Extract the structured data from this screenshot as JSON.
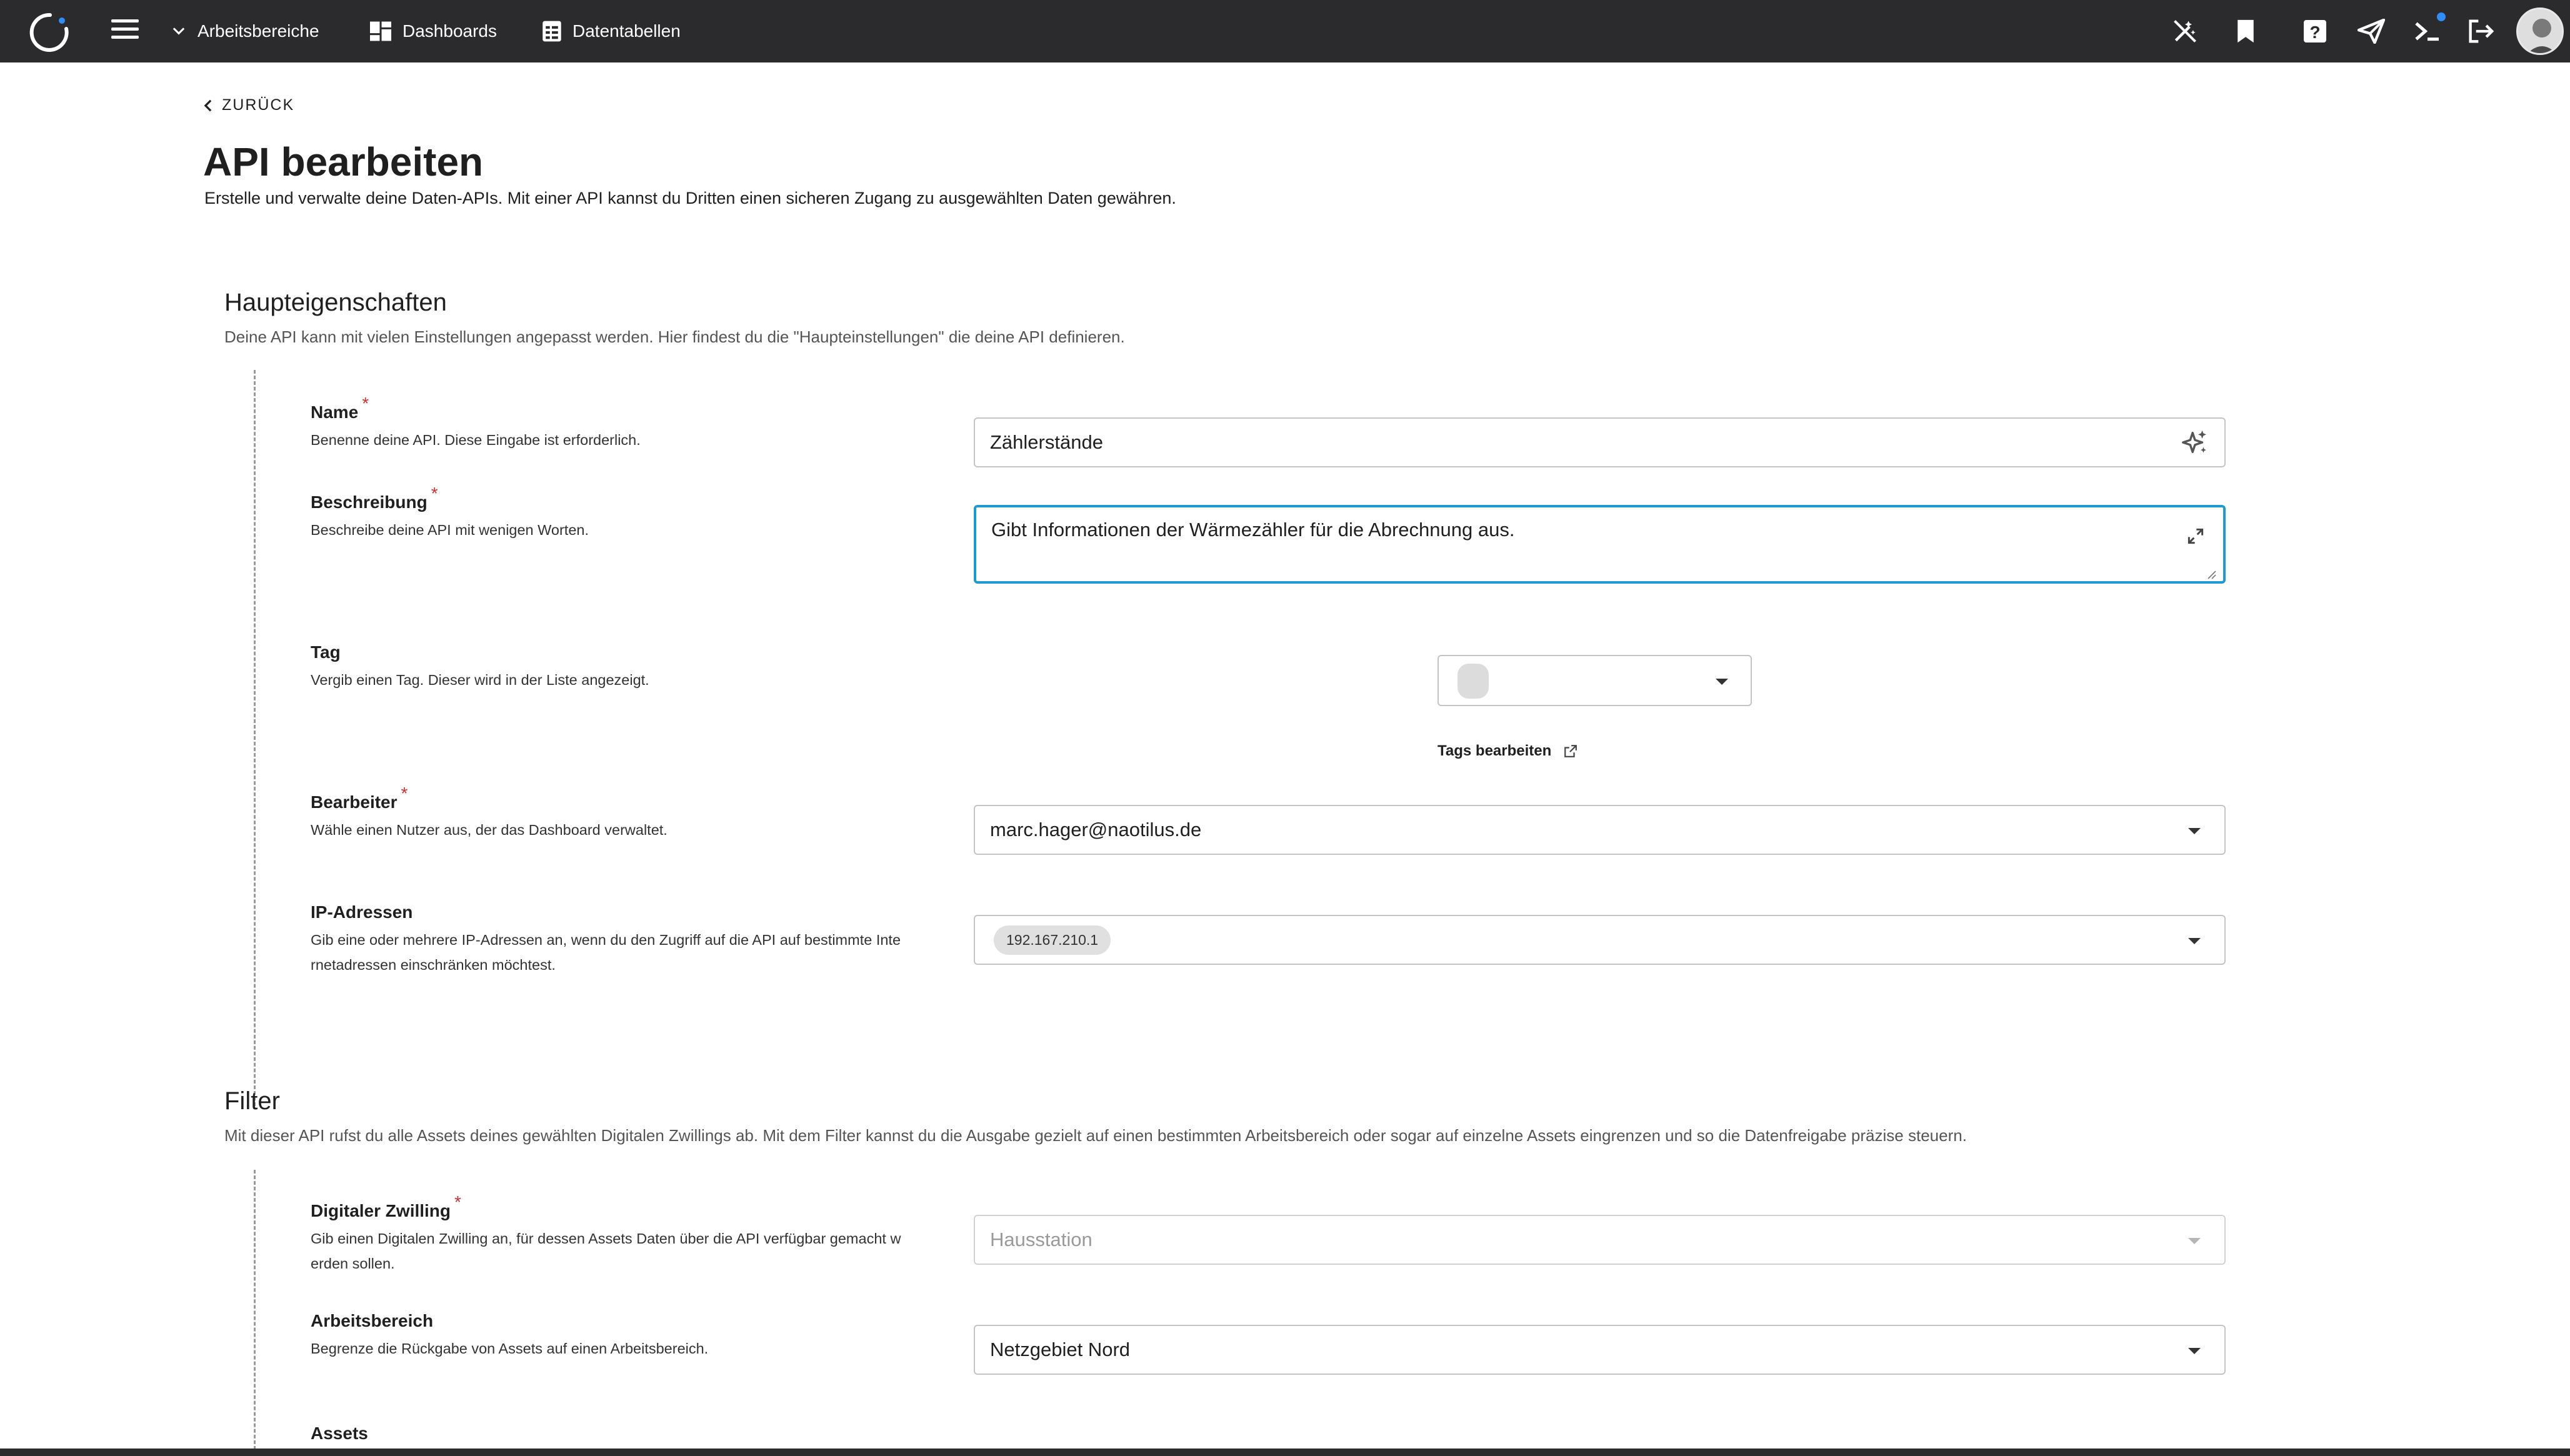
{
  "topbar": {
    "nav": [
      {
        "label": "Arbeitsbereiche",
        "icon": "chevron-down-icon"
      },
      {
        "label": "Dashboards",
        "icon": "dashboard-icon"
      },
      {
        "label": "Datentabellen",
        "icon": "table-icon"
      }
    ],
    "icons": [
      "magic-wand-off-icon",
      "bookmark-icon",
      "help-icon",
      "send-icon",
      "terminal-icon",
      "logout-icon"
    ]
  },
  "page": {
    "back_label": "ZURÜCK",
    "title": "API bearbeiten",
    "subtitle": "Erstelle und verwalte deine Daten-APIs. Mit einer API kannst du Dritten einen sicheren Zugang zu ausgewählten Daten gewähren."
  },
  "main_section": {
    "title": "Haupteigenschaften",
    "subtitle": "Deine API kann mit vielen Einstellungen angepasst werden. Hier findest du die \"Haupteinstellungen\" die deine API definieren.",
    "fields": {
      "name": {
        "label": "Name",
        "required_mark": "*",
        "help": "Benenne deine API. Diese Eingabe ist erforderlich.",
        "value": "Zählerstände"
      },
      "description": {
        "label": "Beschreibung",
        "required_mark": "*",
        "help": "Beschreibe deine API mit wenigen Worten.",
        "value": "Gibt Informationen der Wärmezähler für die Abrechnung aus."
      },
      "tag": {
        "label": "Tag",
        "help": "Vergib einen Tag. Dieser wird in der Liste angezeigt.",
        "edit_label": "Tags bearbeiten"
      },
      "editor": {
        "label": "Bearbeiter",
        "required_mark": "*",
        "help": "Wähle einen Nutzer aus, der das Dashboard verwaltet.",
        "value": "marc.hager@naotilus.de"
      },
      "ip": {
        "label": "IP-Adressen",
        "help_line1": "Gib eine oder mehrere IP-Adressen an, wenn du den Zugriff auf die API auf bestimmte Inte",
        "help_line2": "rnetadressen einschränken möchtest.",
        "chips": [
          "192.167.210.1"
        ]
      }
    }
  },
  "filter_section": {
    "title": "Filter",
    "subtitle": "Mit dieser API rufst du alle Assets deines gewählten Digitalen Zwillings ab. Mit dem Filter kannst du die Ausgabe gezielt auf einen bestimmten Arbeitsbereich oder sogar auf einzelne Assets eingrenzen und so die Datenfreigabe präzise steuern.",
    "fields": {
      "twin": {
        "label": "Digitaler Zwilling",
        "required_mark": "*",
        "help_line1": "Gib einen Digitalen Zwilling an, für dessen Assets Daten über die API verfügbar gemacht w",
        "help_line2": "erden sollen.",
        "value": "Hausstation"
      },
      "workspace": {
        "label": "Arbeitsbereich",
        "help": "Begrenze die Rückgabe von Assets auf einen Arbeitsbereich.",
        "value": "Netzgebiet Nord"
      },
      "assets": {
        "label": "Assets"
      }
    }
  },
  "colors": {
    "accent": "#1e9ad0",
    "required": "#d32f2f",
    "topbar": "#2b2b2e",
    "notification": "#2f8df5"
  }
}
